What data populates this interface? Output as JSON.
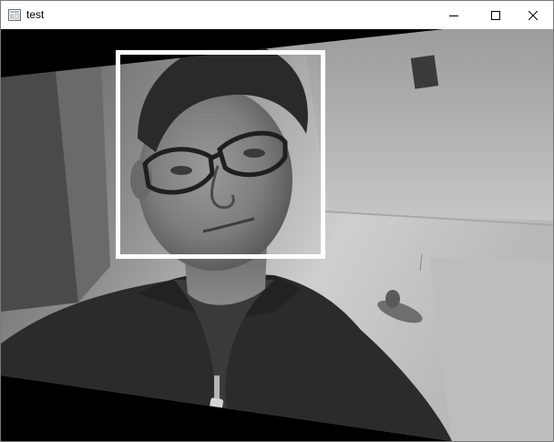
{
  "window": {
    "title": "test"
  },
  "titlebar": {
    "app_icon": "window-app-icon",
    "controls": [
      {
        "name": "minimize",
        "icon": "minimize-icon"
      },
      {
        "name": "maximize",
        "icon": "maximize-icon"
      },
      {
        "name": "close",
        "icon": "close-icon"
      }
    ]
  },
  "canvas": {
    "content": "grayscale-camera-frame",
    "detection_box_color": "#ffffff",
    "background_color": "#000000"
  }
}
